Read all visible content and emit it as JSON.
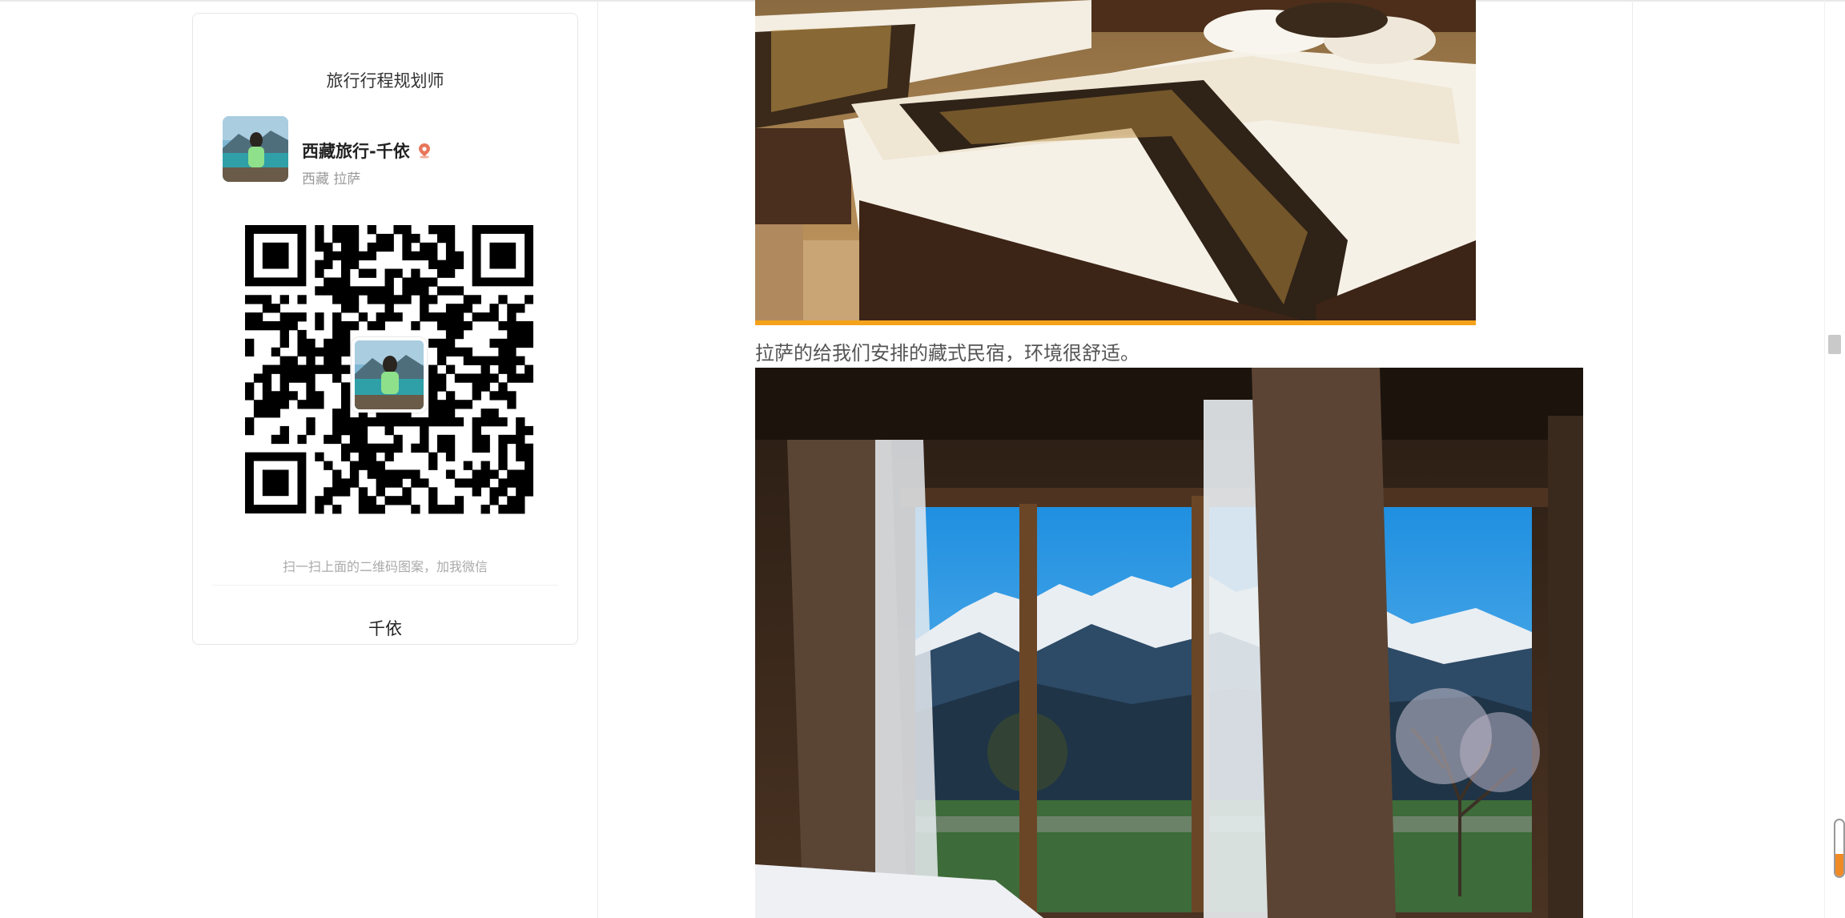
{
  "sidebar": {
    "card_title": "旅行行程规划师",
    "profile": {
      "name": "西藏旅行-千依",
      "location": "西藏 拉萨"
    },
    "qr_hint": "扫一扫上面的二维码图案，加我微信",
    "footer_name": "千依"
  },
  "article": {
    "caption": "拉萨的给我们安排的藏式民宿，环境很舒适。"
  },
  "colors": {
    "accent": "#f5a21b",
    "pin": "#e8765a"
  },
  "icons": {
    "location": "location-pin-icon"
  }
}
